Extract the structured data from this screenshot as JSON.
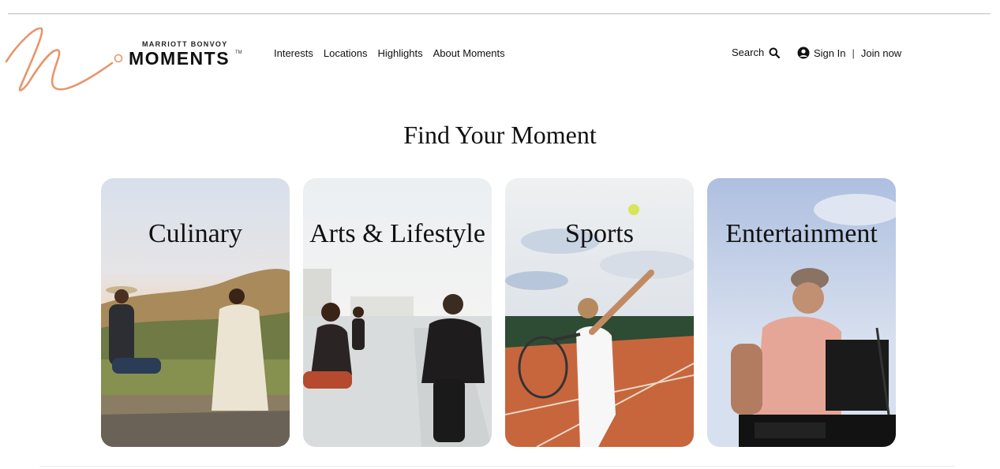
{
  "brand": {
    "small": "MARRIOTT BONVOY",
    "big": "MOMENTS",
    "tm": "TM",
    "accent": "#e8956a"
  },
  "nav": {
    "items": [
      "Interests",
      "Locations",
      "Highlights",
      "About Moments"
    ]
  },
  "header": {
    "search_label": "Search",
    "sign_in": "Sign In",
    "separator": "|",
    "join": "Join now"
  },
  "page": {
    "title": "Find Your Moment"
  },
  "cards": [
    {
      "label": "Culinary"
    },
    {
      "label": "Arts & Lifestyle"
    },
    {
      "label": "Sports"
    },
    {
      "label": "Entertainment"
    }
  ]
}
